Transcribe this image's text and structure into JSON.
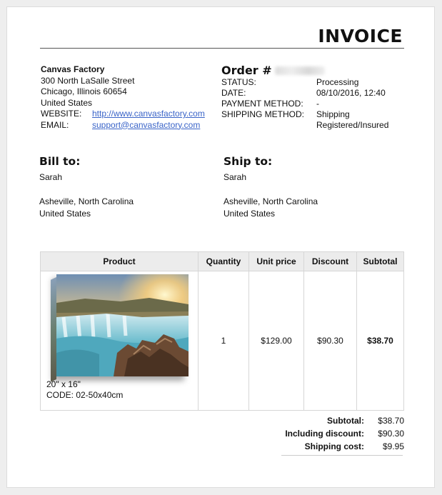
{
  "invoice_title": "INVOICE",
  "company": {
    "name": "Canvas Factory",
    "street": "300 North LaSalle Street",
    "city": "Chicago, Illinois 60654",
    "country": "United States",
    "website_label": "WEBSITE:",
    "website": "http://www.canvasfactory.com",
    "email_label": "EMAIL:",
    "email": "support@canvasfactory.com"
  },
  "order": {
    "title": "Order #",
    "rows": [
      {
        "label": "STATUS:",
        "value": "Processing"
      },
      {
        "label": "DATE:",
        "value": "08/10/2016, 12:40"
      },
      {
        "label": "PAYMENT METHOD:",
        "value": "-"
      },
      {
        "label": "SHIPPING METHOD:",
        "value": "Shipping",
        "value2": "Registered/Insured"
      }
    ]
  },
  "bill_to": {
    "heading": "Bill to:",
    "name": "Sarah",
    "city": "Asheville, North Carolina",
    "country": "United States"
  },
  "ship_to": {
    "heading": "Ship to:",
    "name": "Sarah",
    "city": "Asheville, North Carolina",
    "country": "United States"
  },
  "table": {
    "headers": [
      "Product",
      "Quantity",
      "Unit price",
      "Discount",
      "Subtotal"
    ],
    "rows": [
      {
        "size": "20\" x 16\"",
        "code": "CODE: 02-50x40cm",
        "quantity": "1",
        "unit_price": "$129.00",
        "discount": "$90.30",
        "subtotal": "$38.70"
      }
    ]
  },
  "totals": [
    {
      "label": "Subtotal:",
      "value": "$38.70"
    },
    {
      "label": "Including discount:",
      "value": "$90.30"
    },
    {
      "label": "Shipping cost:",
      "value": "$9.95"
    }
  ],
  "colors": {
    "link": "#3a64c8",
    "header_bg": "#ececec"
  }
}
